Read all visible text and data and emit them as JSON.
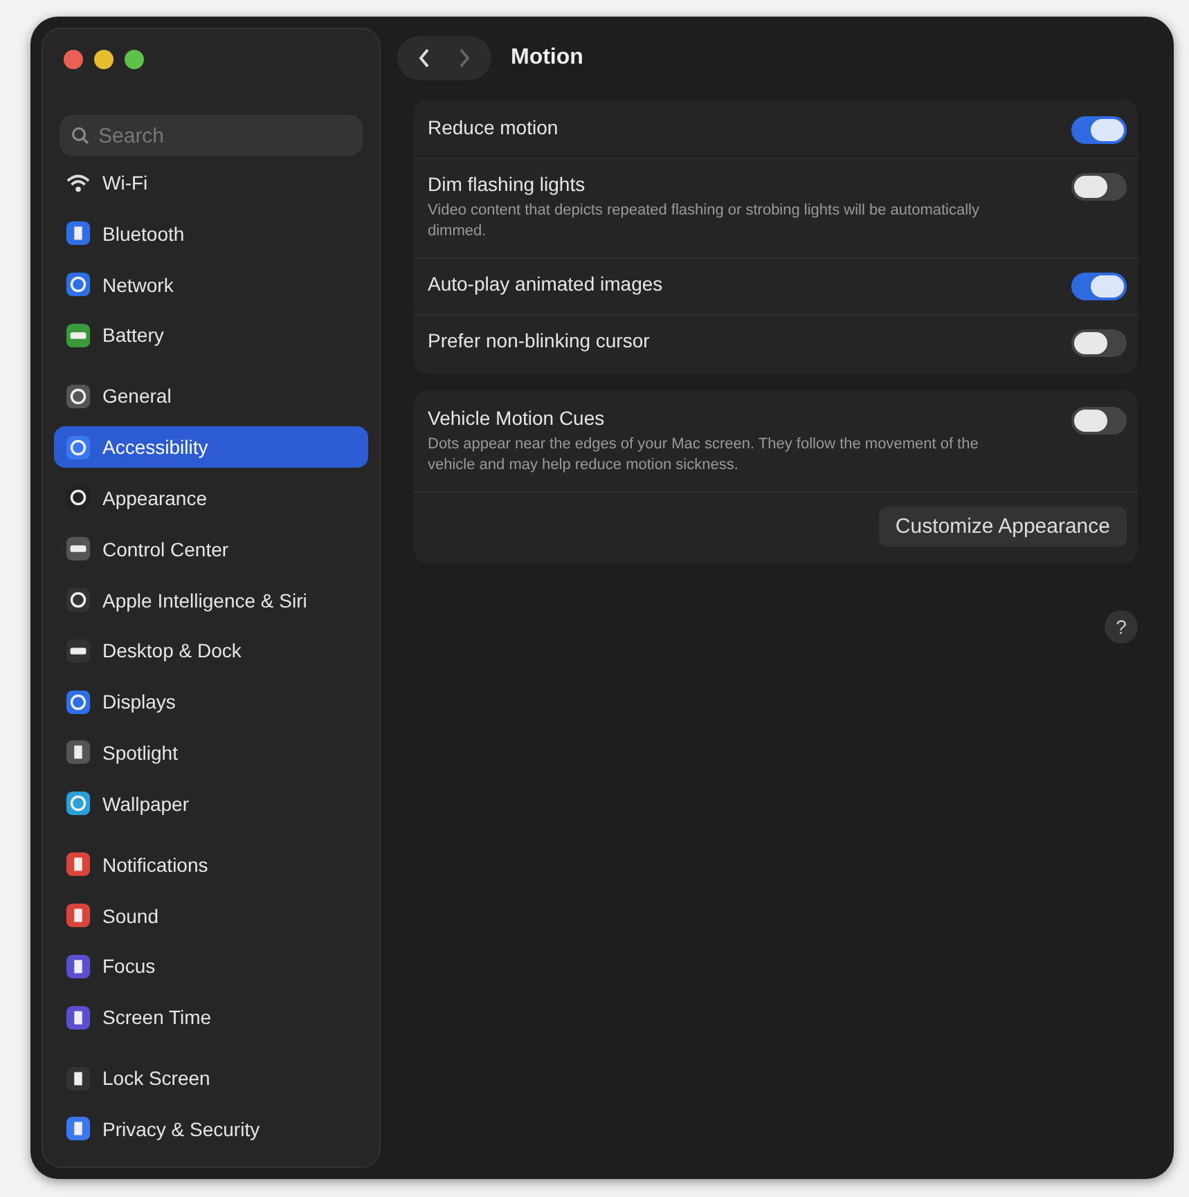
{
  "window": {
    "title": "Motion"
  },
  "search": {
    "placeholder": "Search"
  },
  "sidebar": {
    "groups": [
      {
        "items": [
          {
            "label": "Wi-Fi",
            "kind": "wifi",
            "selected": false
          },
          {
            "label": "Bluetooth",
            "kind": "bluetooth",
            "selected": false
          },
          {
            "label": "Network",
            "kind": "globe",
            "selected": false
          },
          {
            "label": "Battery",
            "kind": "battery",
            "selected": false
          }
        ]
      },
      {
        "items": [
          {
            "label": "General",
            "kind": "gear",
            "selected": false
          },
          {
            "label": "Accessibility",
            "kind": "person",
            "selected": true
          },
          {
            "label": "Appearance",
            "kind": "contrast",
            "selected": false
          },
          {
            "label": "Control Center",
            "kind": "toggles",
            "selected": false
          },
          {
            "label": "Apple Intelligence & Siri",
            "kind": "ring",
            "selected": false
          },
          {
            "label": "Desktop & Dock",
            "kind": "dock",
            "selected": false
          },
          {
            "label": "Displays",
            "kind": "sun",
            "selected": false
          },
          {
            "label": "Spotlight",
            "kind": "search",
            "selected": false
          },
          {
            "label": "Wallpaper",
            "kind": "flower",
            "selected": false
          }
        ]
      },
      {
        "items": [
          {
            "label": "Notifications",
            "kind": "bell",
            "selected": false
          },
          {
            "label": "Sound",
            "kind": "speaker",
            "selected": false
          },
          {
            "label": "Focus",
            "kind": "moon",
            "selected": false
          },
          {
            "label": "Screen Time",
            "kind": "hourglass",
            "selected": false
          }
        ]
      },
      {
        "items": [
          {
            "label": "Lock Screen",
            "kind": "lock",
            "selected": false
          },
          {
            "label": "Privacy & Security",
            "kind": "hand",
            "selected": false
          }
        ]
      }
    ]
  },
  "cards": [
    {
      "rows": [
        {
          "label": "Reduce motion",
          "on": true
        },
        {
          "label": "Dim flashing lights",
          "description": "Video content that depicts repeated flashing or strobing lights will be automatically dimmed.",
          "on": false
        },
        {
          "label": "Auto-play animated images",
          "on": true
        },
        {
          "label": "Prefer non-blinking cursor",
          "on": false
        }
      ]
    },
    {
      "rows": [
        {
          "label": "Vehicle Motion Cues",
          "description": "Dots appear near the edges of your Mac screen. They follow the movement of the vehicle and may help reduce motion sickness.",
          "on": false
        }
      ],
      "button": "Customize Appearance"
    }
  ],
  "help": "?"
}
